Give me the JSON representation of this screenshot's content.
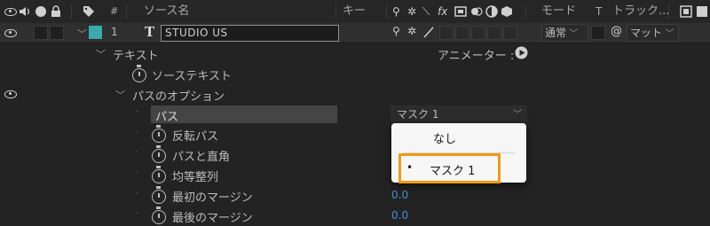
{
  "header": {
    "hash": "#",
    "source_name": "ソース名",
    "keys": "キー",
    "mode": "モード",
    "track_t": "T",
    "track_matte": "トラック..."
  },
  "layer": {
    "number": "1",
    "type_glyph": "T",
    "name": "STUDIO US",
    "label_color": "#3aa9ad",
    "mode_value": "通常",
    "matte_value": "マット"
  },
  "tree": {
    "text_group": "テキスト",
    "animator_label": "アニメーター :",
    "source_text": "ソーステキスト",
    "path_options": "パスのオプション",
    "path": "パス",
    "path_value": "マスク 1",
    "reverse_path": "反転パス",
    "perpendicular": "パスと直角",
    "force_align": "均等整列",
    "first_margin": "最初のマージン",
    "first_margin_value": "0.0",
    "last_margin": "最後のマージン",
    "last_margin_value": "0.0"
  },
  "menu": {
    "none": "なし",
    "mask1": "マスク 1",
    "selected_bullet": "•"
  },
  "colors": {
    "accent_highlight": "#f19a13",
    "value_blue": "#3d8fd6",
    "label_teal": "#3aa9ad"
  }
}
